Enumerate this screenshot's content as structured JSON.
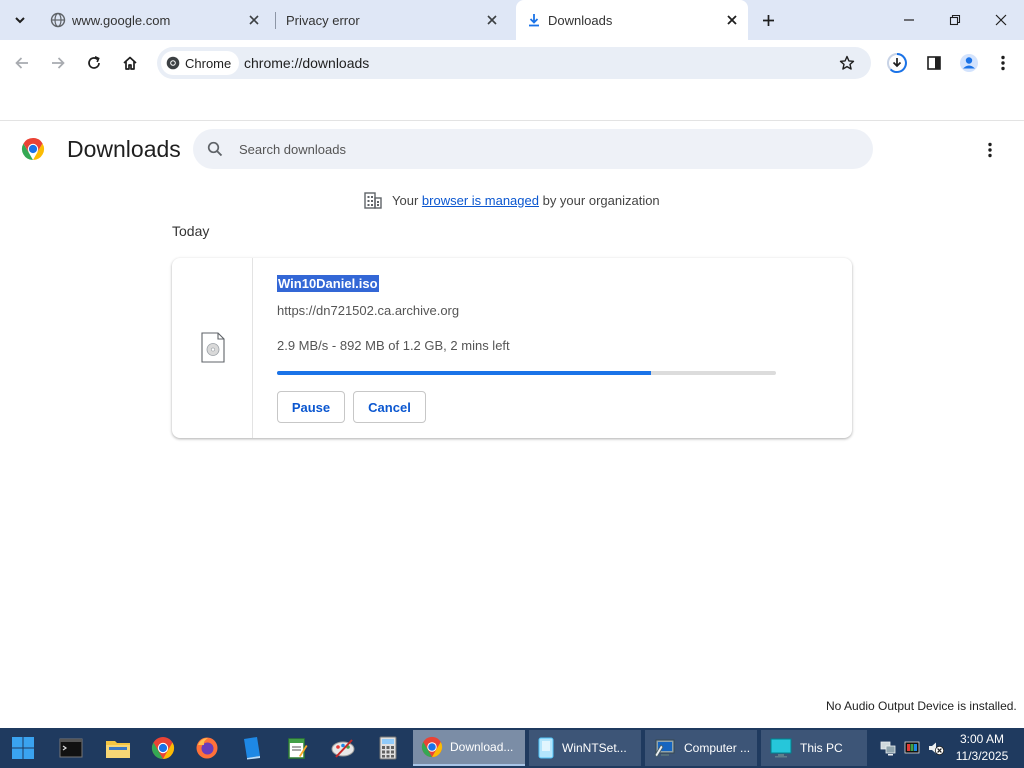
{
  "tabs": [
    {
      "title": "www.google.com",
      "active": false
    },
    {
      "title": "Privacy error",
      "active": false
    },
    {
      "title": "Downloads",
      "active": true
    }
  ],
  "toolbar": {
    "chip_label": "Chrome",
    "url": "chrome://downloads"
  },
  "downloads": {
    "title": "Downloads",
    "search_placeholder": "Search downloads",
    "managed": {
      "before": "Your",
      "link": "browser is managed",
      "after": "by your organization"
    },
    "date_header": "Today",
    "item": {
      "filename": "Win10Daniel.iso",
      "source_url": "https://dn721502.ca.archive.org",
      "status": "2.9 MB/s - 892 MB of 1.2 GB, 2 mins left",
      "progress_fraction": 0.75,
      "pause_label": "Pause",
      "cancel_label": "Cancel"
    }
  },
  "notification": "No Audio Output Device is installed.",
  "taskbar": {
    "tasks": [
      {
        "label": "Download...",
        "active": true
      },
      {
        "label": "WinNTSet...",
        "active": false
      },
      {
        "label": "Computer ...",
        "active": false
      },
      {
        "label": "This PC",
        "active": false
      }
    ],
    "time": "3:00 AM",
    "date": "11/3/2025"
  },
  "colors": {
    "accent": "#1a73e8",
    "link": "#0b57d0",
    "taskbar": "#1f3a5f",
    "tabstrip": "#dfe7f6"
  }
}
